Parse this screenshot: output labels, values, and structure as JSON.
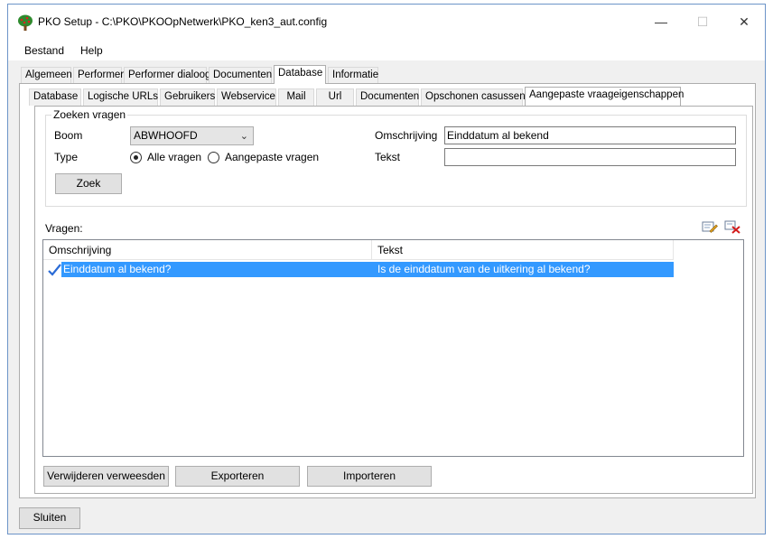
{
  "window": {
    "title": "PKO Setup - C:\\PKO\\PKOOpNetwerk\\PKO_ken3_aut.config",
    "minimize_glyph": "—",
    "maximize_glyph": "☐",
    "close_glyph": "✕"
  },
  "menu": {
    "items": [
      "Bestand",
      "Help"
    ]
  },
  "main_tabs": [
    "Algemeen",
    "Performer",
    "Performer dialoog",
    "Documenten",
    "Database",
    "Informatie"
  ],
  "main_tabs_active": "Database",
  "sub_tabs": [
    "Database",
    "Logische URLs",
    "Gebruikers",
    "Webservice",
    "Mail",
    "Url",
    "Documenten",
    "Opschonen casussen",
    "Aangepaste vraageigenschappen"
  ],
  "sub_tabs_active": "Aangepaste vraageigenschappen",
  "search": {
    "group_label": "Zoeken vragen",
    "boom_label": "Boom",
    "boom_value": "ABWHOOFD",
    "type_label": "Type",
    "radio_all_label": "Alle vragen",
    "radio_custom_label": "Aangepaste vragen",
    "selected_radio": "Alle vragen",
    "omschrijving_label": "Omschrijving",
    "omschrijving_value": "Einddatum al bekend",
    "tekst_label": "Tekst",
    "tekst_value": "",
    "search_button": "Zoek"
  },
  "questions": {
    "label": "Vragen:",
    "columns": [
      "Omschrijving",
      "Tekst"
    ],
    "rows": [
      {
        "omschrijving": "Einddatum al bekend?",
        "tekst": "Is de einddatum van de uitkering al bekend?",
        "checked": true
      }
    ],
    "edit_icon": "edit-icon",
    "delete_icon": "delete-icon"
  },
  "actions": {
    "remove_orphans": "Verwijderen verweesden",
    "export": "Exporteren",
    "import": "Importeren"
  },
  "footer": {
    "close_button": "Sluiten"
  },
  "colors": {
    "selection": "#3399ff",
    "window_bg": "#f0f0f0",
    "border_accent": "#6c94c8"
  }
}
